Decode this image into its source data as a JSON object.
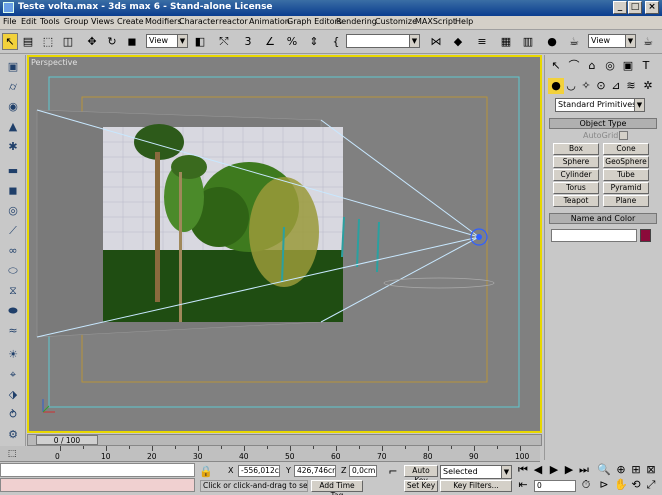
{
  "window": {
    "title": "Teste volta.max - 3ds max 6 - Stand-alone License",
    "controls": [
      "_",
      "□",
      "×"
    ]
  },
  "menu": [
    "File",
    "Edit",
    "Tools",
    "Group",
    "Views",
    "Create",
    "Modifiers",
    "Character",
    "reactor",
    "Animation",
    "Graph Editors",
    "Rendering",
    "Customize",
    "MAXScript",
    "Help"
  ],
  "toolbar": {
    "ref_coord": "View",
    "selection_set": "",
    "view_combo": "View"
  },
  "viewport": {
    "label": "Perspective"
  },
  "command_panel": {
    "category": "Standard Primitives",
    "object_type_header": "Object Type",
    "autogrid": "AutoGrid",
    "buttons": [
      "Box",
      "Cone",
      "Sphere",
      "GeoSphere",
      "Cylinder",
      "Tube",
      "Torus",
      "Pyramid",
      "Teapot",
      "Plane"
    ],
    "name_color_header": "Name and Color",
    "name_value": "",
    "color": "#8b0a3a"
  },
  "time": {
    "slider_label": "0 / 100",
    "ticks": [
      "0",
      "10",
      "20",
      "30",
      "40",
      "50",
      "60",
      "70",
      "80",
      "90",
      "100"
    ]
  },
  "status": {
    "x_label": "X",
    "x_value": "-556,012cr",
    "y_label": "Y",
    "y_value": "426,746cr",
    "z_label": "Z",
    "z_value": "0,0cm",
    "prompt": "Click or click-and-drag to select ob",
    "add_time_tag": "Add Time Tag",
    "auto_key": "Auto Key",
    "set_key": "Set Key",
    "key_mode": "Selected",
    "key_filters": "Key Filters...",
    "frame": "0"
  },
  "colors": {
    "viewport_border": "#e8d800",
    "title_bar": "#0a3d8f"
  }
}
